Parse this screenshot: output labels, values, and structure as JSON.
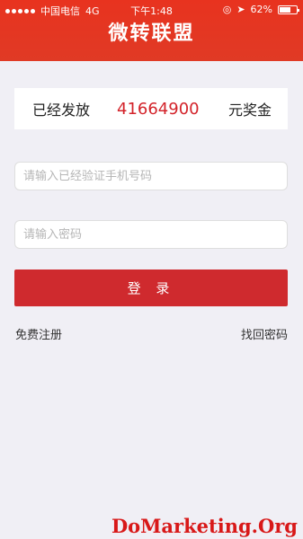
{
  "status_bar": {
    "carrier": "中国电信",
    "network": "4G",
    "time": "下午1:48",
    "battery": "62%"
  },
  "header": {
    "title": "微转联盟"
  },
  "prize": {
    "prefix": "已经发放",
    "amount": "41664900",
    "suffix": "元奖金"
  },
  "form": {
    "phone_placeholder": "请输入已经验证手机号码",
    "password_placeholder": "请输入密码",
    "login_label": "登 录"
  },
  "links": {
    "register": "免费注册",
    "forgot": "找回密码"
  },
  "watermark": "DoMarketing.Org",
  "colors": {
    "brand_red": "#e8331f",
    "button_red": "#cf2a2e",
    "amount_red": "#d3232a"
  }
}
